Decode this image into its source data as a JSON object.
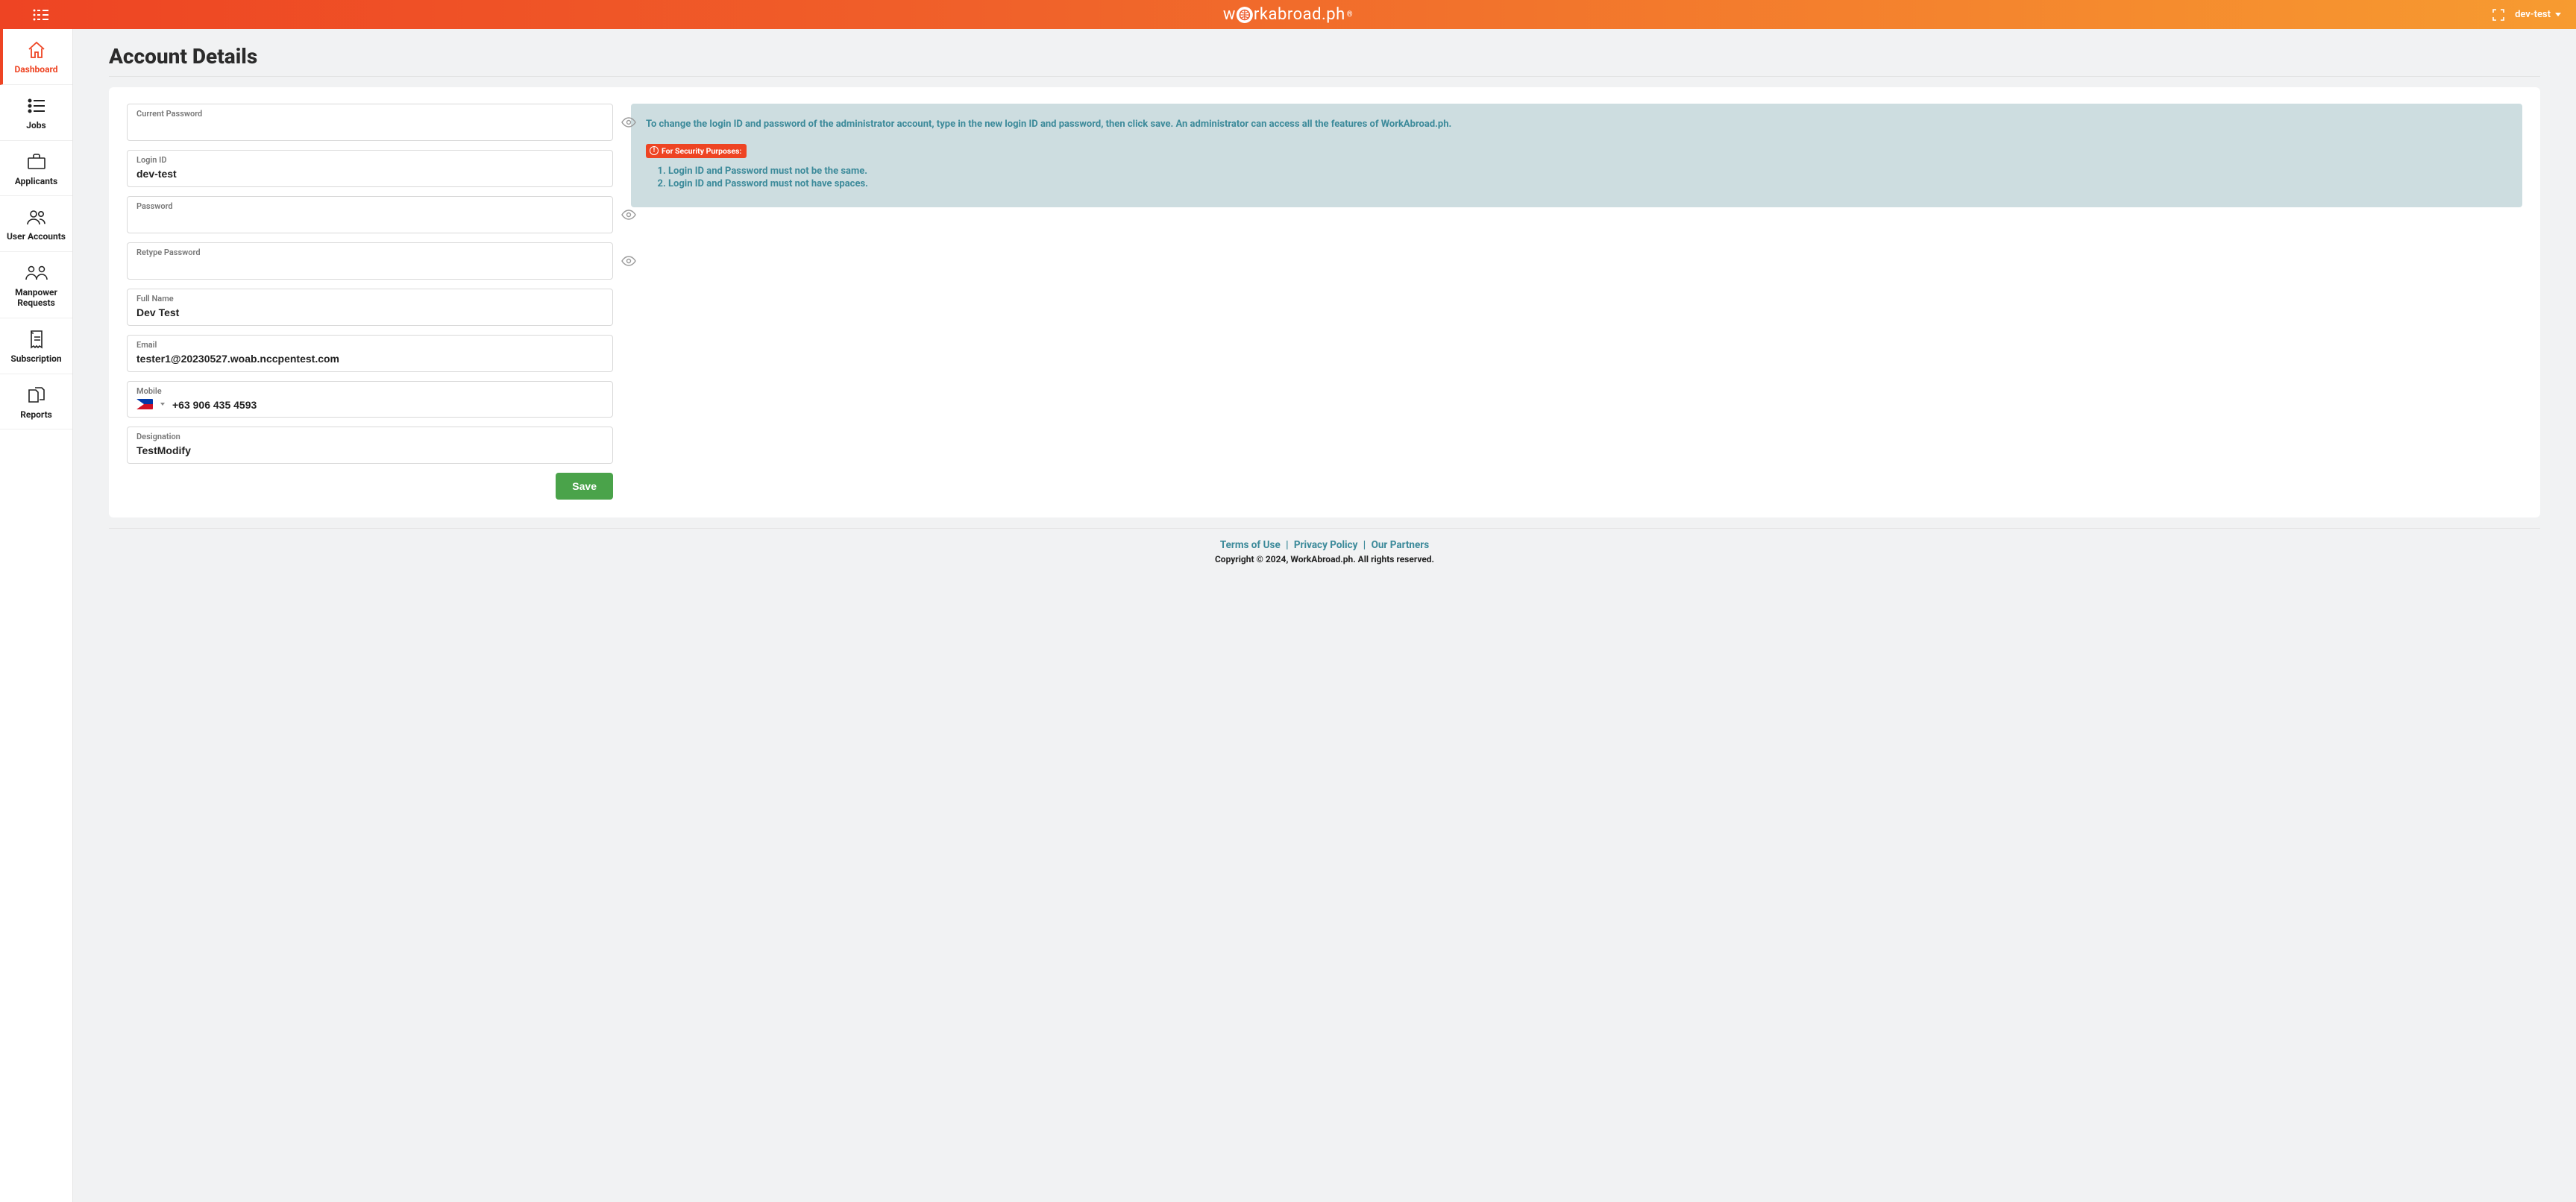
{
  "header": {
    "brand_prefix": "w",
    "brand_mid": "rkabroad.ph",
    "user_label": "dev-test"
  },
  "sidebar": {
    "items": [
      {
        "label": "Dashboard",
        "active": true
      },
      {
        "label": "Jobs"
      },
      {
        "label": "Applicants"
      },
      {
        "label": "User Accounts"
      },
      {
        "label": "Manpower Requests"
      },
      {
        "label": "Subscription"
      },
      {
        "label": "Reports"
      }
    ]
  },
  "page": {
    "title": "Account Details"
  },
  "form": {
    "current_password": {
      "label": "Current Password",
      "value": ""
    },
    "login_id": {
      "label": "Login ID",
      "value": "dev-test"
    },
    "password": {
      "label": "Password",
      "value": ""
    },
    "retype_password": {
      "label": "Retype Password",
      "value": ""
    },
    "full_name": {
      "label": "Full Name",
      "value": "Dev Test"
    },
    "email": {
      "label": "Email",
      "value": "tester1@20230527.woab.nccpentest.com"
    },
    "mobile": {
      "label": "Mobile",
      "value": "+63 906 435 4593"
    },
    "designation": {
      "label": "Designation",
      "value": "TestModify"
    },
    "save_label": "Save"
  },
  "info": {
    "paragraph": "To change the login ID and password of the administrator account, type in the new login ID and password, then click save. An administrator can access all the features of WorkAbroad.ph.",
    "badge": "For Security Purposes:",
    "rules": [
      "Login ID and Password must not be the same.",
      "Login ID and Password must not have spaces."
    ]
  },
  "footer": {
    "links": [
      "Terms of Use",
      "Privacy Policy",
      "Our Partners"
    ],
    "copyright": "Copyright © 2024, WorkAbroad.ph. All rights reserved."
  }
}
